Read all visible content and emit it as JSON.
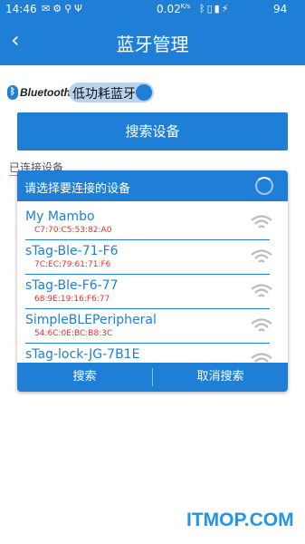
{
  "status_bar": {
    "time": "14:46",
    "left_icons": [
      "message-icon",
      "settings-icon",
      "share-icon",
      "usb-icon"
    ],
    "speed": "0.02",
    "speed_unit": "K/s",
    "right_icons": [
      "bluetooth-icon",
      "vibrate-icon",
      "sim-icon",
      "charging-icon"
    ],
    "battery": "94"
  },
  "app_bar": {
    "back_icon": "back-arrow-icon",
    "title": "蓝牙管理"
  },
  "bluetooth": {
    "logo_text": "Bluetooth",
    "low_energy_label": "低功耗蓝牙",
    "toggle_on": true
  },
  "search_button": "搜索设备",
  "connected_label": "已连接设备",
  "dialog": {
    "title": "请选择要连接的设备",
    "devices": [
      {
        "name": "My Mambo",
        "mac": "C7:70:C5:53:82:A0"
      },
      {
        "name": "sTag-Ble-71-F6",
        "mac": "7C:EC:79:61:71:F6"
      },
      {
        "name": "sTag-Ble-F6-77",
        "mac": "68:9E:19:16:F6:77"
      },
      {
        "name": "SimpleBLEPeripheral",
        "mac": "54:6C:0E:BC:B8:3C"
      },
      {
        "name": "sTag-lock-JG-7B1E",
        "mac": ""
      }
    ],
    "search_label": "搜索",
    "cancel_label": "取消搜索"
  },
  "watermark": "ITMOP.COM",
  "colors": {
    "primary": "#1f7fd6",
    "mac_text": "#e23030",
    "wifi_icon": "#bbbbbb"
  }
}
